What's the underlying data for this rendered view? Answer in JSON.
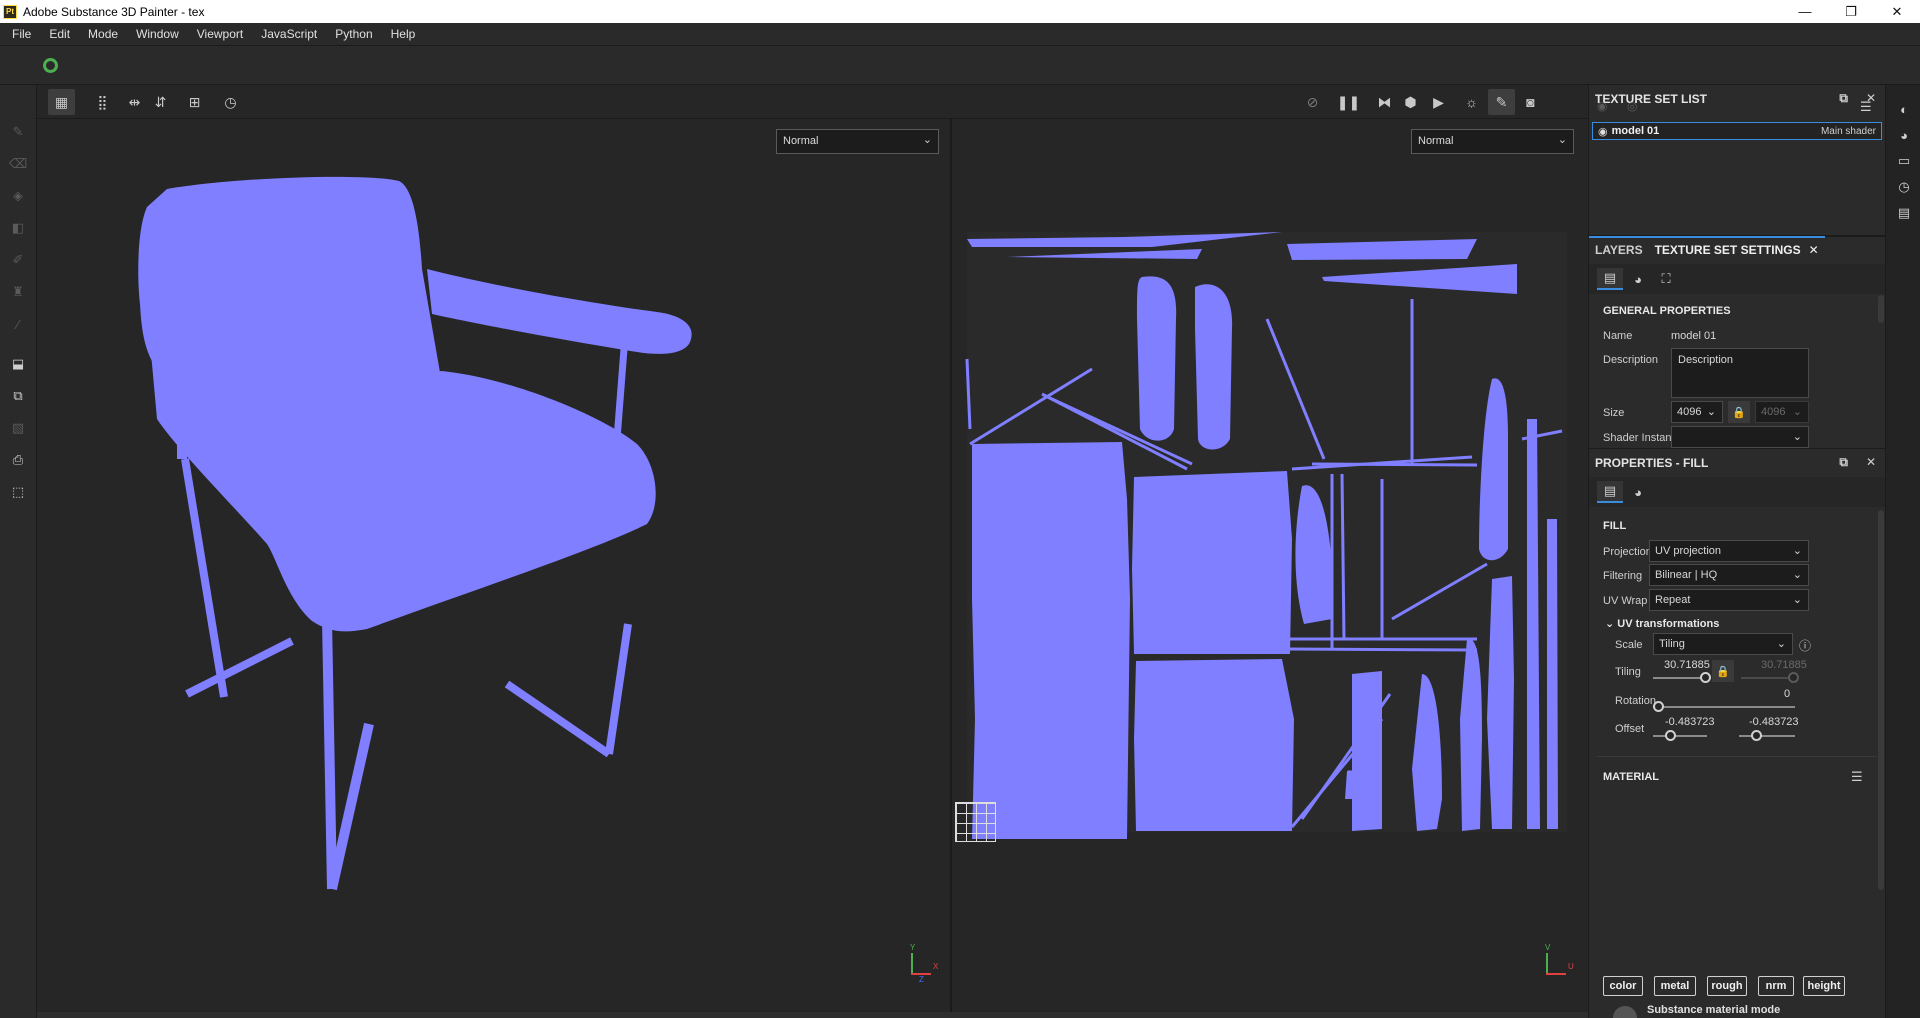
{
  "window": {
    "logo": "Pt",
    "title": "Adobe Substance 3D Painter - tex",
    "controls": [
      "—",
      "❐",
      "✕"
    ]
  },
  "menu": [
    "File",
    "Edit",
    "Mode",
    "Window",
    "Viewport",
    "JavaScript",
    "Python",
    "Help"
  ],
  "viewport3d": {
    "mode": "Normal"
  },
  "viewport2d": {
    "mode": "Normal"
  },
  "gizmo3d": {
    "y": "Y",
    "x": "X",
    "z": "Z"
  },
  "gizmo2d": {
    "v": "V",
    "u": "U"
  },
  "texture_set_list": {
    "title": "TEXTURE SET LIST",
    "item_name": "model 01",
    "item_shader": "Main shader"
  },
  "layers_panel": {
    "tab_layers": "LAYERS",
    "tab_settings": "TEXTURE SET SETTINGS",
    "section": "GENERAL PROPERTIES",
    "name_label": "Name",
    "name_value": "model 01",
    "description_label": "Description",
    "description_value": "Description",
    "size_label": "Size",
    "size_value": "4096",
    "size_value_2": "4096",
    "shader_label": "Shader Instance"
  },
  "properties": {
    "title": "PROPERTIES - FILL",
    "section_fill": "FILL",
    "projection_label": "Projection",
    "projection_value": "UV projection",
    "filtering_label": "Filtering",
    "filtering_value": "Bilinear | HQ",
    "uvwrap_label": "UV Wrap",
    "uvwrap_value": "Repeat",
    "uvtrans_label": "UV transformations",
    "scale_label": "Scale",
    "scale_value": "Tiling",
    "tiling_label": "Tiling",
    "tiling_value": "30.71885",
    "tiling_value_2": "30.71885",
    "rotation_label": "Rotation",
    "rotation_value": "0",
    "offset_label": "Offset",
    "offset_x": "-0.483723",
    "offset_y": "-0.483723",
    "section_material": "MATERIAL",
    "channels": [
      "color",
      "metal",
      "rough",
      "nrm",
      "height"
    ],
    "substance_label": "Substance material mode"
  },
  "colors": {
    "mesh": "#7f7fff",
    "accent": "#3a8dde",
    "panel": "#2b2b2b",
    "viewport": "#262626"
  }
}
